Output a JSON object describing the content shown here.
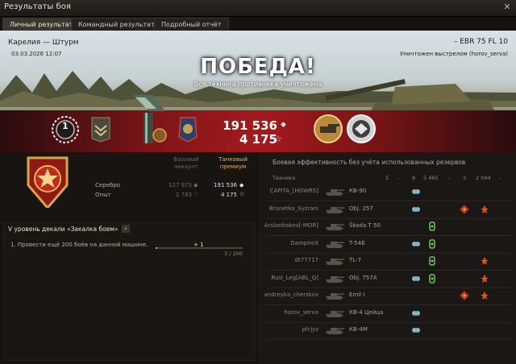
{
  "window": {
    "title": "Результаты боя",
    "close_glyph": "✕"
  },
  "tabs": [
    {
      "label": "Личный результат",
      "active": true
    },
    {
      "label": "Командный результат",
      "active": false
    },
    {
      "label": "Подробный отчёт",
      "active": false
    }
  ],
  "banner": {
    "map": "Карелия — Штурм",
    "date": "03.03.2026 12:07",
    "result": "ПОБЕДА!",
    "result_sub": "Вся техника противника уничтожена",
    "vehicle": "– EBR 75 FL 10",
    "killed_by": "Уничтожен выстрелом (horov_serva)"
  },
  "summary": {
    "credits": "191 536",
    "xp": "4 175",
    "credit_icon": "◆",
    "xp_icon": "☆",
    "rank_number": "1"
  },
  "earnings": {
    "col_basic": "Базовый аккаунт",
    "col_premium": "Танковый премиум",
    "rows": [
      {
        "label": "Серебро",
        "basic": "127 973",
        "premium": "191 536",
        "basic_icon": "◆",
        "premium_icon": "◆"
      },
      {
        "label": "Опыт",
        "basic": "2 783",
        "premium": "4 175",
        "basic_icon": "☆",
        "premium_icon": "☆"
      }
    ]
  },
  "task": {
    "title": "V уровень декали «Закалка боем»",
    "arrow": "›",
    "line": "1. Провести ещё 200 боёв на данной машине.",
    "plus": "+ 1",
    "progress_text": "3 / 200",
    "progress": 0.015
  },
  "efficiency": {
    "title": "Боевая эффективность без учёта использованных резервов",
    "col_tech": "Техника",
    "col_sigma": "Σ",
    "col_dash": "-",
    "col_spot": "9",
    "col_assist": "5 465",
    "col_dash2": "-",
    "col_crit": "3",
    "col_dmg": "2 044",
    "col_dash3": "-",
    "rows": [
      {
        "player": "CAPITA_[HGWRS]",
        "tank": "КВ-90",
        "icons": [
          "spot"
        ]
      },
      {
        "player": "Brunetka_Syzrani",
        "tank": "Obj. 257",
        "icons": [
          "spot",
          "crit",
          "dmg"
        ]
      },
      {
        "player": "Arslanbakov[-MOR]",
        "tank": "Škoda T 50",
        "icons": [
          "assist"
        ]
      },
      {
        "player": "DampireX",
        "tank": "T-54Б",
        "icons": [
          "spot",
          "assist"
        ]
      },
      {
        "player": "dt77717",
        "tank": "TL-7",
        "icons": [
          "assist",
          "dmg"
        ]
      },
      {
        "player": "Rusl_Leg[ABL_Q]",
        "tank": "Obj. 757A",
        "icons": [
          "spot",
          "assist",
          "dmg"
        ]
      },
      {
        "player": "andreyka_cherskov",
        "tank": "Emil I",
        "icons": [
          "crit",
          "dmg"
        ]
      },
      {
        "player": "horov_serva",
        "tank": "КВ-4 Цейца",
        "icons": [
          "spot"
        ]
      },
      {
        "player": "pfcjyz",
        "tank": "КВ-4М",
        "icons": [
          "spot"
        ]
      }
    ]
  },
  "colors": {
    "accent_red": "#a31a1d",
    "gold": "#d8a64a",
    "premium_gold": "#e0b24c"
  }
}
